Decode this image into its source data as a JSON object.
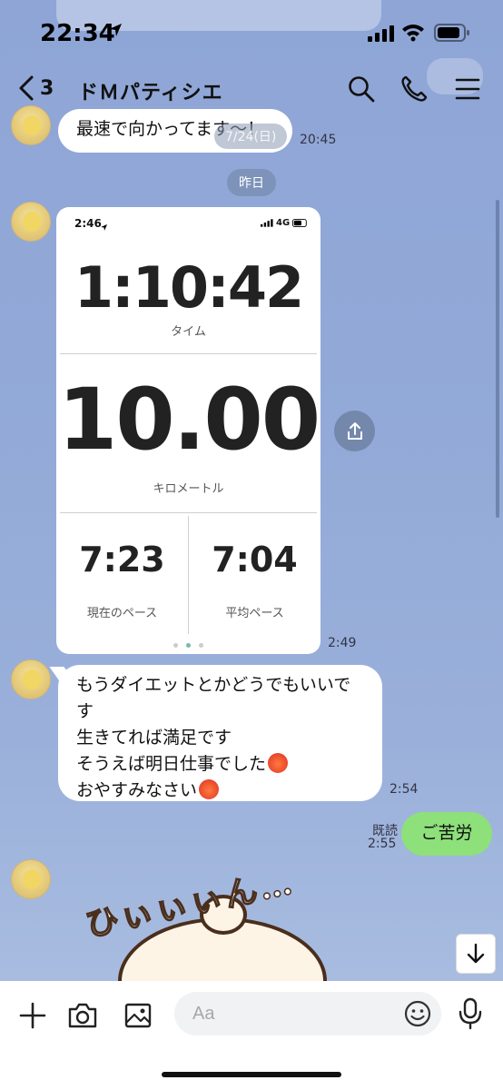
{
  "status": {
    "time": "22:34"
  },
  "header": {
    "back_count": "3",
    "title": "ドＭパティシエ"
  },
  "messages": {
    "m1": {
      "text": "最速で向かってます〜！",
      "time": "20:45"
    },
    "ghost_date": "7/24(日)",
    "date_separator": "昨日",
    "card_time": "2:49",
    "m3": {
      "lines": [
        "もうダイエットとかどうでもいいで",
        "す",
        "生きてれば満足です",
        "そうえば明日仕事でした",
        "おやすみなさい"
      ],
      "time": "2:54"
    },
    "m4": {
      "text": "ご苦労",
      "read": "既読",
      "time": "2:55"
    },
    "sticker_text": "ひぃぃぃん…"
  },
  "run_card": {
    "status_time": "2:46",
    "network": "4G",
    "duration": "1:10:42",
    "duration_label": "タイム",
    "distance": "10.00",
    "distance_label": "キロメートル",
    "current_pace": "7:23",
    "current_pace_label": "現在のペース",
    "avg_pace": "7:04",
    "avg_pace_label": "平均ペース"
  },
  "input": {
    "placeholder": "Aa"
  },
  "colors": {
    "chat_bg": "#8ea5d6",
    "sent_bubble": "#8de07a",
    "received_bubble": "#ffffff",
    "page_dot_active": "#7ab8b0"
  }
}
